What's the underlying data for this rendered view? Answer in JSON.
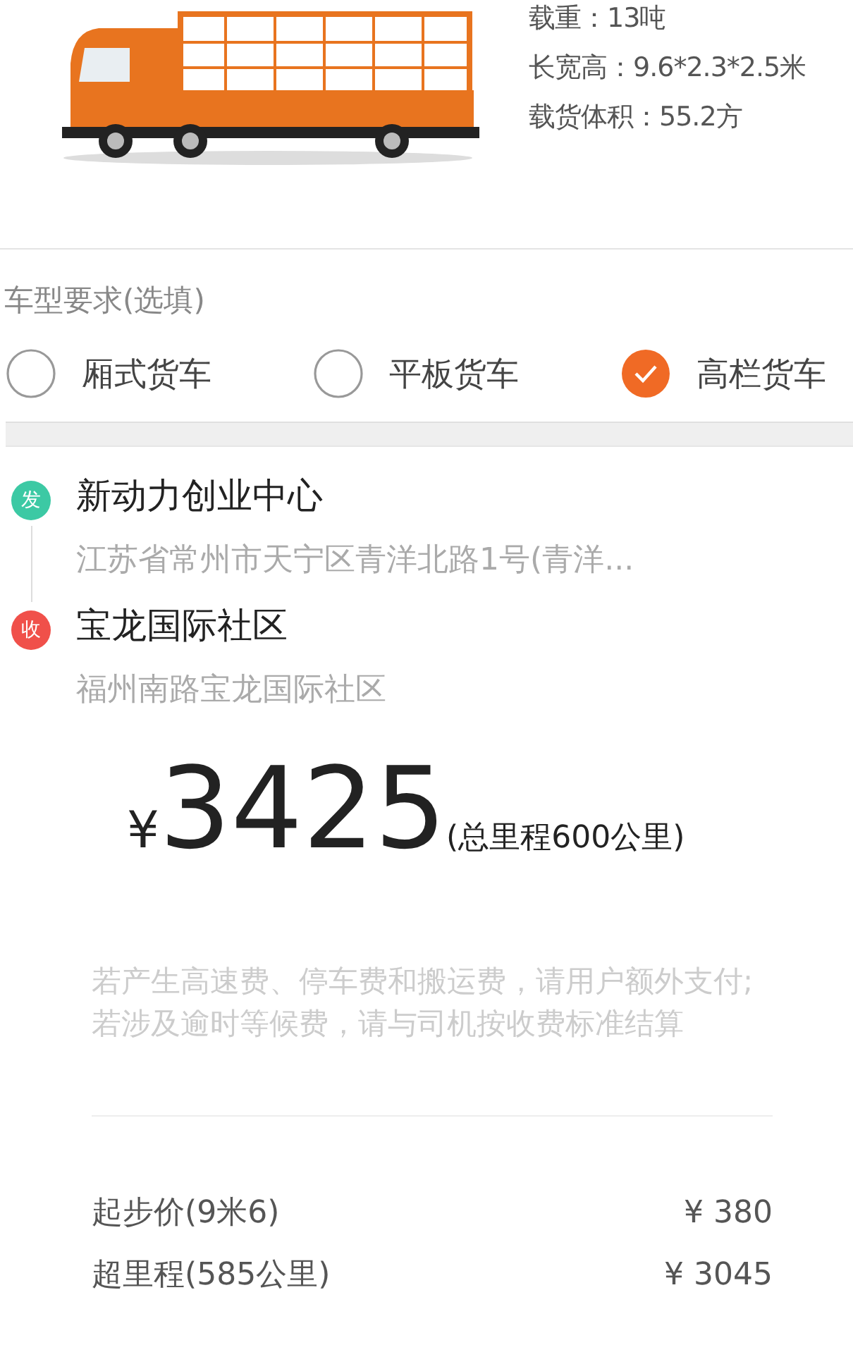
{
  "vehicle": {
    "specs": [
      "载重：13吨",
      "长宽高：9.6*2.3*2.5米",
      "载货体积：55.2方"
    ]
  },
  "truck_type": {
    "title": "车型要求(选填)",
    "options": [
      {
        "label": "厢式货车",
        "selected": false
      },
      {
        "label": "平板货车",
        "selected": false
      },
      {
        "label": "高栏货车",
        "selected": true
      }
    ]
  },
  "route": [
    {
      "kind": "start",
      "badge": "发",
      "color": "#3cc9a4",
      "name": "新动力创业中心",
      "address": "江苏省常州市天宁区青洋北路1号(青洋..."
    },
    {
      "kind": "end",
      "badge": "收",
      "color": "#f0504a",
      "name": "宝龙国际社区",
      "address": "福州南路宝龙国际社区"
    }
  ],
  "price": {
    "currency": "¥",
    "amount": "3425",
    "distance": "(总里程600公里)"
  },
  "notice": "若产生高速费、停车费和搬运费，请用户额外支付;若涉及逾时等候费，请与司机按收费标准结算",
  "fees": [
    {
      "label": "起步价(9米6)",
      "value": "¥ 380"
    },
    {
      "label": "超里程(585公里)",
      "value": "¥ 3045"
    }
  ]
}
